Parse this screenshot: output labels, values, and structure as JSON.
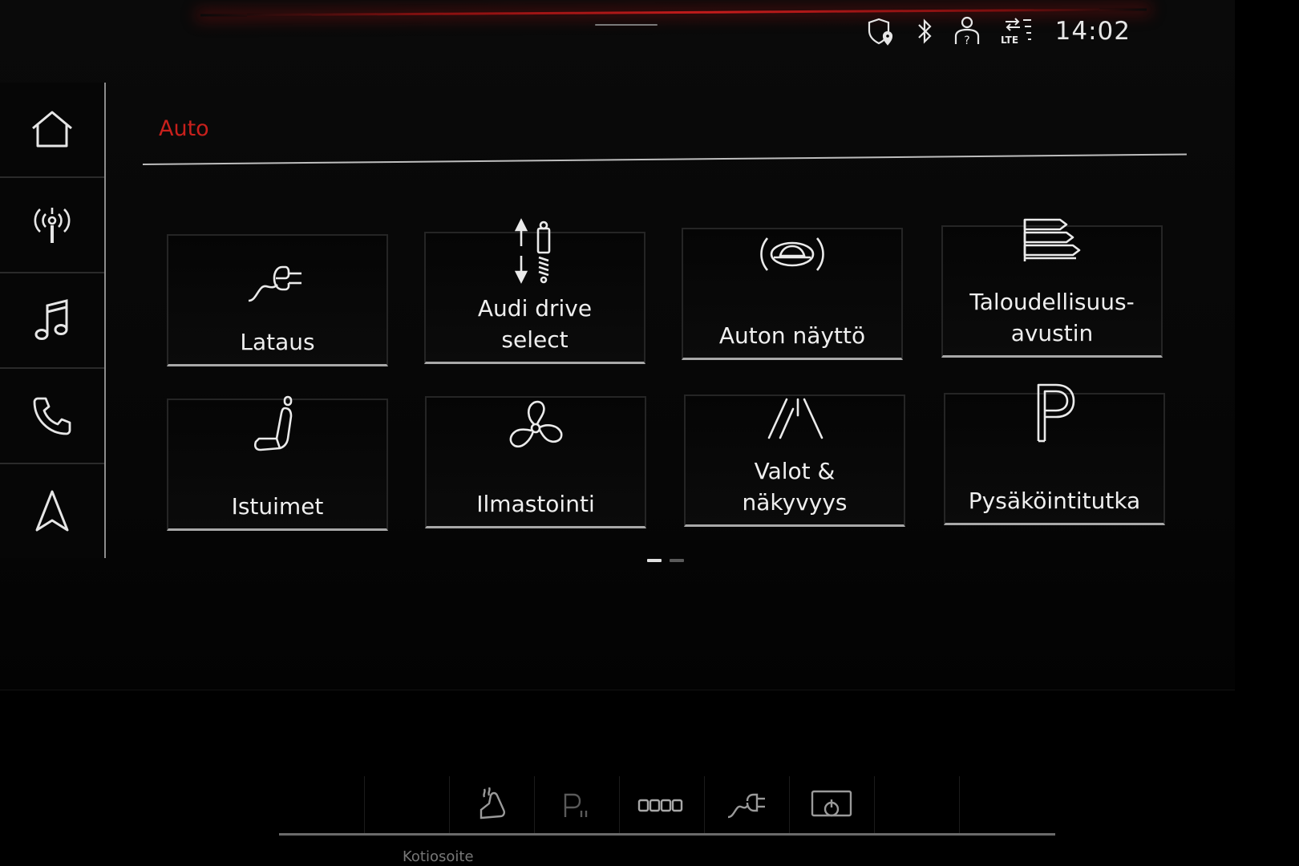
{
  "status": {
    "time": "14:02",
    "lte_label": "LTE",
    "icons": [
      "shield-location-icon",
      "bluetooth-icon",
      "profile-icon",
      "lte-signal-icon"
    ]
  },
  "sidebar": {
    "items": [
      {
        "icon": "home-icon"
      },
      {
        "icon": "radio-icon"
      },
      {
        "icon": "music-icon"
      },
      {
        "icon": "phone-icon"
      },
      {
        "icon": "navigation-icon"
      }
    ]
  },
  "page": {
    "title": "Auto",
    "title_color": "#c8201c"
  },
  "tiles": [
    {
      "label_lines": [
        "Lataus"
      ],
      "icon": "charging-plug-icon"
    },
    {
      "label_lines": [
        "Audi drive",
        "select"
      ],
      "icon": "suspension-icon"
    },
    {
      "label_lines": [
        "Auton näyttö"
      ],
      "icon": "car-display-icon"
    },
    {
      "label_lines": [
        "Taloudellisuus-",
        "avustin"
      ],
      "icon": "efficiency-icon"
    },
    {
      "label_lines": [
        "Istuimet"
      ],
      "icon": "seat-icon"
    },
    {
      "label_lines": [
        "Ilmastointi"
      ],
      "icon": "fan-icon"
    },
    {
      "label_lines": [
        "Valot &",
        "näkyvyys"
      ],
      "icon": "lights-road-icon"
    },
    {
      "label_lines": [
        "Pysäköintitutka"
      ],
      "icon": "parking-icon"
    }
  ],
  "pager": {
    "pages": 2,
    "active": 0
  },
  "bottom_bar": {
    "label": "Kotiosoite",
    "icons": [
      "seat-heat-icon",
      "parking-assist-icon",
      "battery-level-icon",
      "charging-plug-icon",
      "display-off-icon"
    ]
  }
}
